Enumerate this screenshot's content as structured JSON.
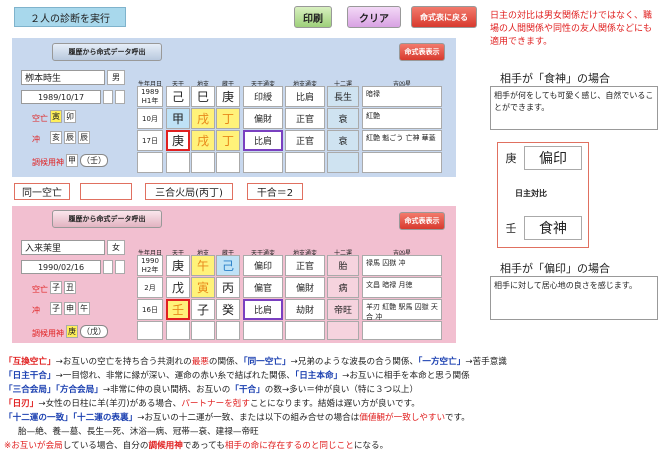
{
  "title": "２人の診断を実行",
  "toolbar": {
    "print": "印刷",
    "clear": "クリア",
    "back": "命式表に戻る"
  },
  "note": "日主の対比は男女関係だけではなく、職場の人間関係や同性の友人関係などにも適用できます。",
  "headers": {
    "birth": "生年月日",
    "tenkan": "天干",
    "chishi": "地支",
    "zokan": "蔵干",
    "tsuhen_ten": "天干通変",
    "tsuhen_chi": "地支通変",
    "juni": "十二運",
    "kikyo": "吉凶星"
  },
  "person1": {
    "load_btn": "履歴から命式データ呼出",
    "show_btn": "命式表表示",
    "name": "栁本時生",
    "gender": "男",
    "birthdate": "1989/10/17",
    "kubo_label": "空亡",
    "kubo": [
      "寅",
      "卯"
    ],
    "chu_label": "冲",
    "chu": [
      "亥",
      "辰",
      "辰"
    ],
    "chokou_label": "調候用神",
    "chokou": [
      "甲",
      "（",
      "壬",
      "）"
    ],
    "rows": [
      {
        "b": [
          "1989",
          "H1年"
        ],
        "ten": "己",
        "chi": "巳",
        "zo": "庚",
        "t1": "印綬",
        "t2": "比肩",
        "j": "長生",
        "k": "暗禄"
      },
      {
        "b": [
          "10月"
        ],
        "ten": "甲",
        "chi": "戌",
        "zo": "丁",
        "t1": "偏財",
        "t2": "正官",
        "j": "衰",
        "k": "紅艶"
      },
      {
        "b": [
          "17日"
        ],
        "ten": "庚",
        "chi": "戌",
        "zo": "丁",
        "t1": "比肩",
        "t2": "正官",
        "j": "衰",
        "k": "紅艶 魁ごう 亡神 華蓋"
      }
    ]
  },
  "person2": {
    "load_btn": "履歴から命式データ呼出",
    "show_btn": "命式表表示",
    "name": "入来茉里",
    "gender": "女",
    "birthdate": "1990/02/16",
    "kubo_label": "空亡",
    "kubo": [
      "子",
      "丑"
    ],
    "chu_label": "冲",
    "chu": [
      "子",
      "申",
      "午"
    ],
    "chokou_label": "調候用神",
    "chokou": [
      "庚",
      "（",
      "戊",
      "）"
    ],
    "rows": [
      {
        "b": [
          "1990",
          "H2年"
        ],
        "ten": "庚",
        "chi": "午",
        "zo": "己",
        "t1": "偏印",
        "t2": "正官",
        "j": "胎",
        "k": "禄馬 囚獄 冲"
      },
      {
        "b": [
          "2月"
        ],
        "ten": "戊",
        "chi": "寅",
        "zo": "丙",
        "t1": "偏官",
        "t2": "偏財",
        "j": "病",
        "k": "文昌 暗禄 月徳"
      },
      {
        "b": [
          "16日"
        ],
        "ten": "壬",
        "chi": "子",
        "zo": "癸",
        "t1": "比肩",
        "t2": "劫財",
        "j": "帝旺",
        "k": "羊刃 紅艶 駅馬 囚獄 天合 冲"
      }
    ]
  },
  "relations": {
    "a": "同一空亡",
    "b": "",
    "c": "三合火局(丙丁)",
    "d": "干合＝2"
  },
  "aite1": {
    "label": "相手が「食神」の場合",
    "text": "相手が何をしても可愛く感じ、自然でいることができます。"
  },
  "aite2": {
    "label": "相手が「偏印」の場合",
    "text": "相手に対して居心地の良さを感じます。"
  },
  "taihi": {
    "top_stem": "庚",
    "top_star": "偏印",
    "label": "日主対比",
    "bottom_stem": "壬",
    "bottom_star": "食神"
  },
  "legend": {
    "l1": [
      "「互換空亡」",
      "→お互いの空亡を持ち合う共測れの",
      "最悪",
      "の関係、",
      "「同一空亡」",
      "→兄弟のような波長の合う関係、",
      "「一方空亡」",
      "→苦手意識"
    ],
    "l2": [
      "「日主干合」",
      "→一目惚れ、非常に縁が深い、運命の赤い糸で結ばれた関係、",
      "「日主本命」",
      "→お互いに相手を本命と思う関係"
    ],
    "l3": [
      "「三合会局」",
      "「方合会局」",
      "→非常に仲の良い間柄、お互いの",
      "「干合」",
      "の数→多い＝仲が良い（特に３つ以上）"
    ],
    "l4": [
      "「日刃」",
      "→女性の日柱に羊(羊刃)がある場合、",
      "パートナーを剋す",
      "ことになります。結婚は遅い方が良いです。"
    ],
    "l5": [
      "「十二運の一致」",
      "「十二運の表裏」",
      "→お互いの十二運が一致、または以下の組み合せの場合は",
      "価値観が一致しやすい",
      "です。"
    ],
    "l6": [
      "胎—絶、養—墓、長生—死、沐浴—病、冠帯—衰、建禄—帝旺"
    ],
    "l7": [
      "※",
      "お互いが会局",
      "している場合、自分の",
      "調候用神",
      "であっても",
      "相手の命に存在するのと同じこと",
      "になる。"
    ]
  }
}
